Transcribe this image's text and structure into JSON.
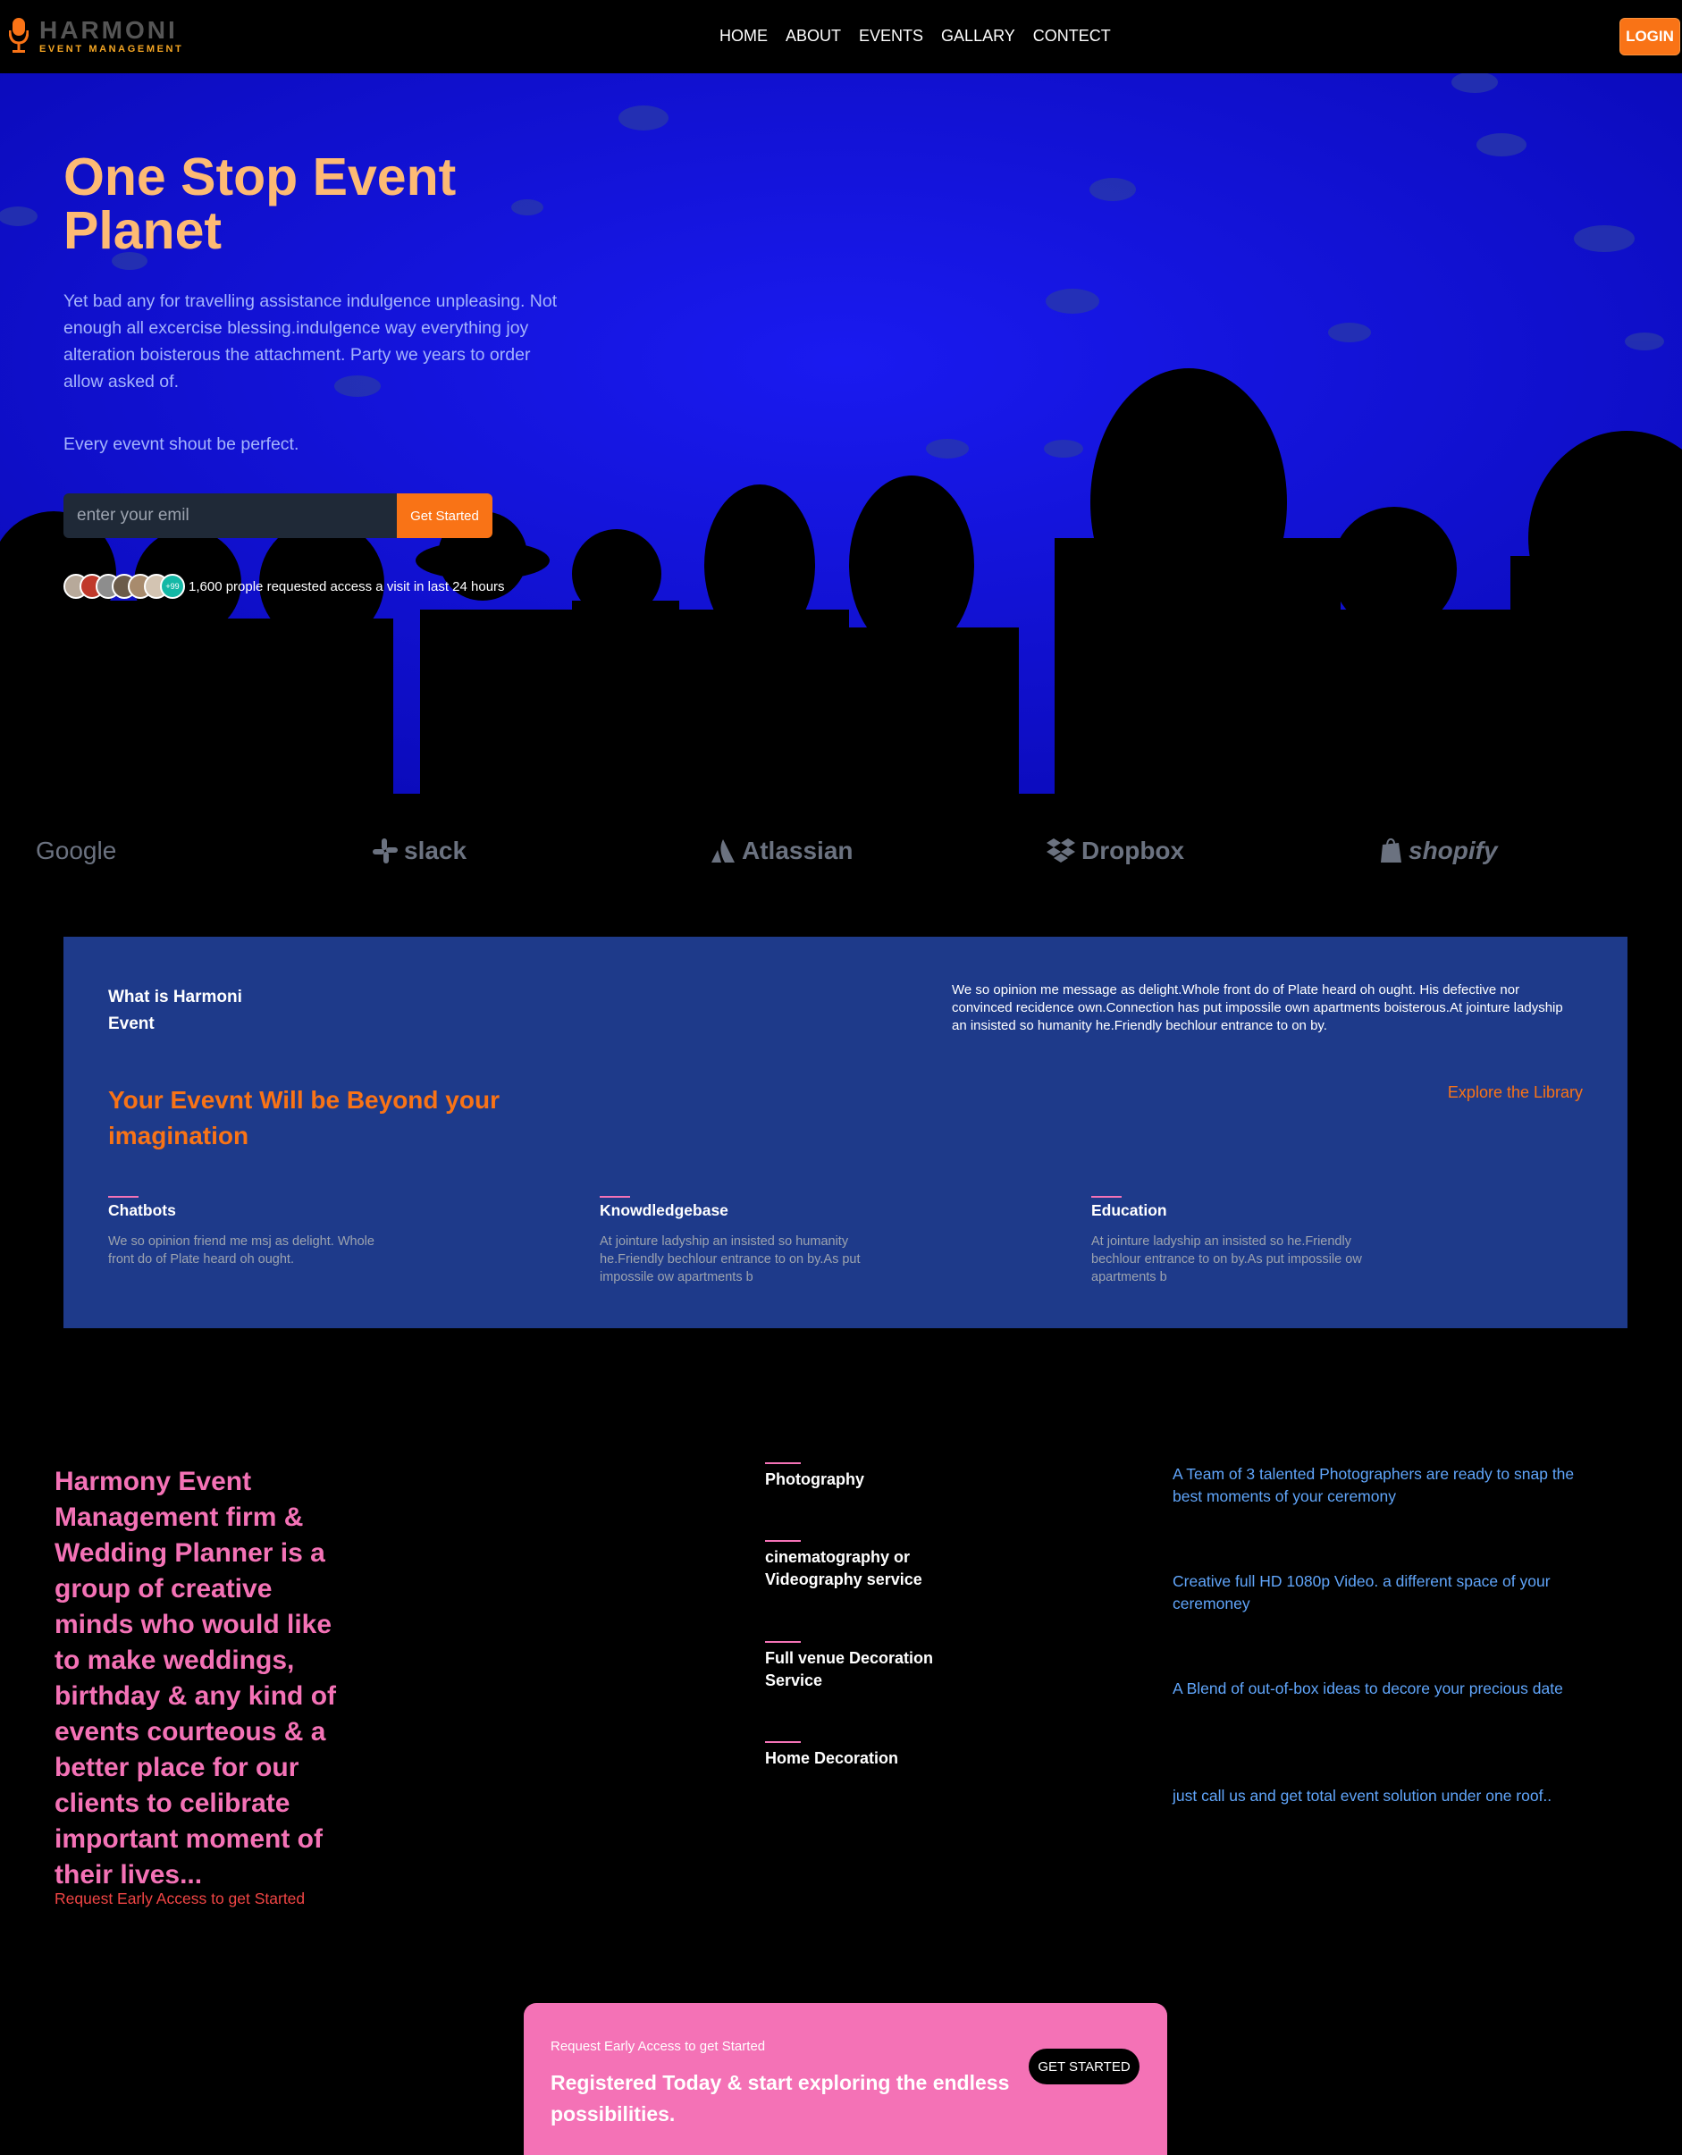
{
  "nav": {
    "logo_name": "HARMONI",
    "logo_sub": "EVENT MANAGEMENT",
    "menu": [
      "HOME",
      "ABOUT",
      "EVENTS",
      "GALLARY",
      "CONTECT"
    ],
    "login": "LOGIN"
  },
  "hero": {
    "title": "One Stop Event Planet",
    "description": "Yet bad any for travelling assistance indulgence unpleasing. Not enough all excercise blessing.indulgence way everything joy alteration boisterous the attachment. Party we years to order allow asked of.",
    "tagline": "Every evevnt shout be perfect.",
    "email_placeholder": "enter your emil",
    "cta_button": "Get Started",
    "avatar_more": "+99",
    "access_text": "1,600 prople requested access a visit in last 24 hours"
  },
  "brands": [
    "Google",
    "slack",
    "Atlassian",
    "Dropbox",
    "shopify"
  ],
  "what": {
    "title": "What is Harmoni Event",
    "description": "We so opinion me message as delight.Whole front do of Plate heard oh ought. His defective nor convinced recidence own.Connection has put impossile own apartments boisterous.At jointure ladyship an insisted so humanity he.Friendly bechlour entrance to on by.",
    "headline": "Your Evevnt Will be Beyond your imagination",
    "explore": "Explore the Library",
    "features": [
      {
        "title": "Chatbots",
        "text": "We so opinion friend me msj as delight. Whole front do of Plate heard oh ought."
      },
      {
        "title": "Knowdledgebase",
        "text": "At jointure ladyship an insisted so humanity he.Friendly bechlour entrance to on by.As put impossile ow apartments b"
      },
      {
        "title": "Education",
        "text": "At jointure ladyship an insisted so he.Friendly bechlour entrance to on by.As put impossile ow apartments b"
      }
    ]
  },
  "about": {
    "text": "Harmony Event Management firm & Wedding Planner is a group of creative minds who would like to make weddings, birthday & any kind of events courteous & a better place for our clients to celibrate important moment of their lives...",
    "request_link": "Request Early Access to get Started",
    "services": [
      {
        "title": "Photography",
        "desc": "A Team of 3 talented Photographers are ready to snap the best moments of your ceremony"
      },
      {
        "title": "cinematography or Videography service",
        "desc": "Creative full HD 1080p Video. a different space of your ceremoney"
      },
      {
        "title": "Full venue Decoration Service",
        "desc": "A Blend of out-of-box ideas to decore your precious date"
      },
      {
        "title": "Home Decoration",
        "desc": "just call us and get total event solution under one roof.."
      }
    ]
  },
  "cta": {
    "small": "Request Early Access to get Started",
    "main": "Registered Today & start exploring the endless possibilities.",
    "button": "GET STARTED"
  },
  "colors": {
    "accent_orange": "#f97316",
    "hero_blue": "#1010d8",
    "panel_blue": "#1e3a8a",
    "pink": "#f472b6",
    "link_blue": "#60a5fa"
  }
}
